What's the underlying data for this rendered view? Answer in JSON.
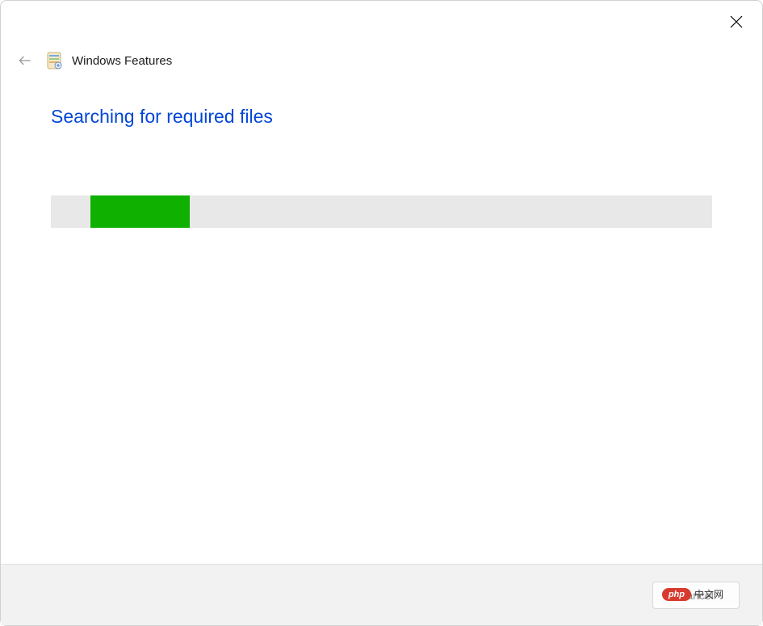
{
  "window": {
    "title": "Windows Features",
    "close_label": "Close"
  },
  "header": {
    "back_label": "Back"
  },
  "heading": "Searching for required files",
  "progress": {
    "fill_left_percent": 6,
    "fill_width_percent": 15,
    "bar_color": "#e8e8e8",
    "fill_color": "#0fb000"
  },
  "footer": {
    "cancel_label": "Cancel"
  },
  "watermark": {
    "pill": "php",
    "text": "中文网"
  },
  "colors": {
    "heading_color": "#0046d5",
    "footer_bg": "#f2f2f2"
  }
}
